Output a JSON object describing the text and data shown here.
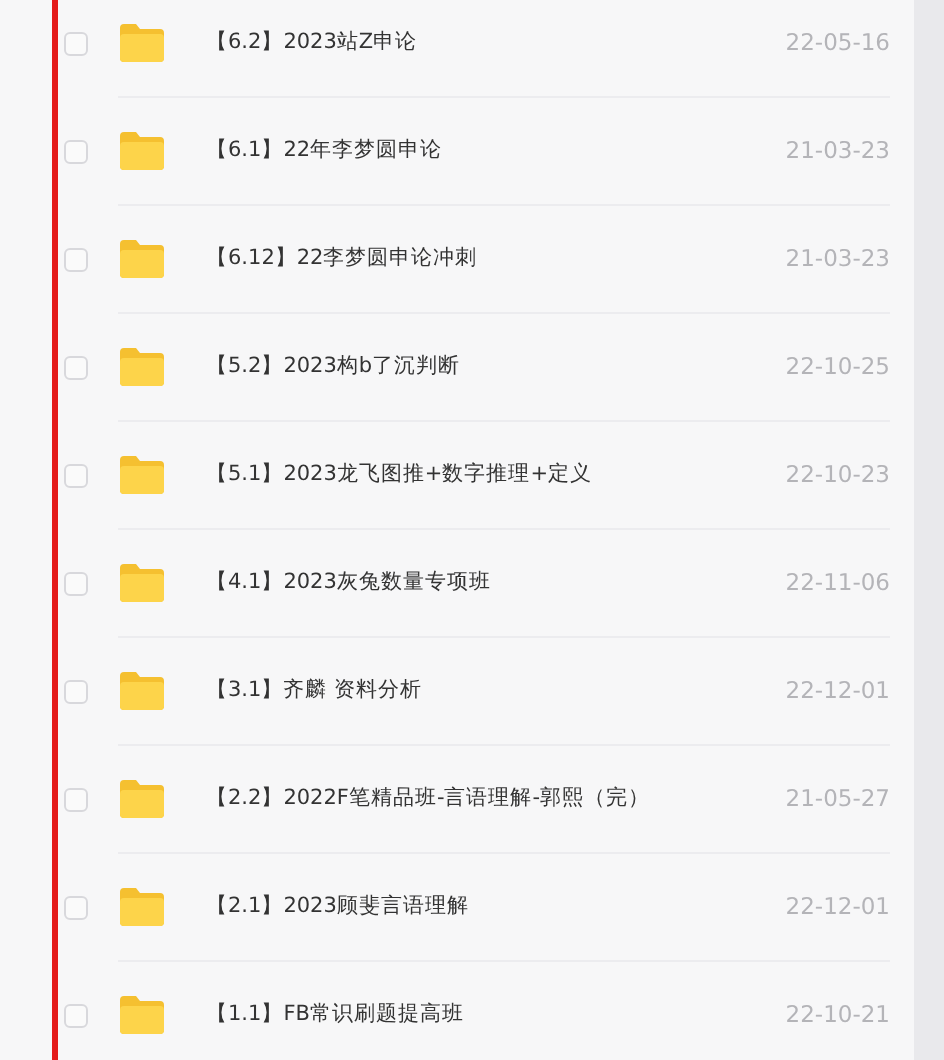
{
  "files": [
    {
      "name": "【6.2】2023站Z申论",
      "date": "22-05-16",
      "checked": false
    },
    {
      "name": "【6.1】22年李梦圆申论",
      "date": "21-03-23",
      "checked": false
    },
    {
      "name": "【6.12】22李梦圆申论冲刺",
      "date": "21-03-23",
      "checked": false
    },
    {
      "name": "【5.2】2023构b了沉判断",
      "date": "22-10-25",
      "checked": false
    },
    {
      "name": "【5.1】2023龙飞图推+数字推理+定义",
      "date": "22-10-23",
      "checked": false
    },
    {
      "name": "【4.1】2023灰兔数量专项班",
      "date": "22-11-06",
      "checked": false
    },
    {
      "name": "【3.1】齐麟 资料分析",
      "date": "22-12-01",
      "checked": false
    },
    {
      "name": "【2.2】2022F笔精品班-言语理解-郭熙（完）",
      "date": "21-05-27",
      "checked": false
    },
    {
      "name": "【2.1】2023顾斐言语理解",
      "date": "22-12-01",
      "checked": false
    },
    {
      "name": "【1.1】FB常识刷题提高班",
      "date": "22-10-21",
      "checked": false
    }
  ]
}
